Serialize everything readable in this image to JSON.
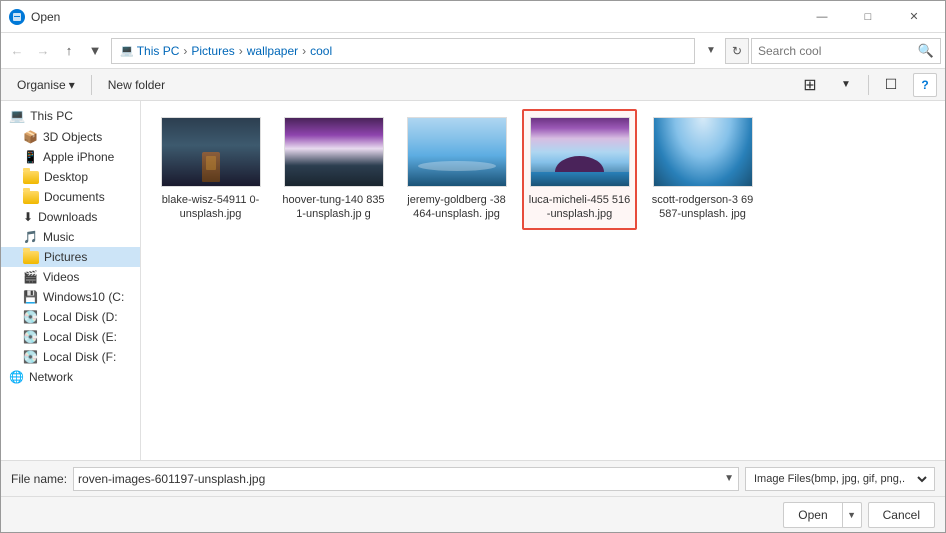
{
  "window": {
    "title": "Open",
    "icon": "open-folder-icon"
  },
  "title_bar_controls": {
    "minimize": "—",
    "maximize": "□",
    "close": "✕"
  },
  "nav": {
    "back": "←",
    "forward": "→",
    "up": "↑",
    "recent": "▾",
    "refresh": "⟳"
  },
  "breadcrumb": {
    "items": [
      {
        "label": "This PC",
        "icon": "computer-icon"
      },
      {
        "label": "Pictures",
        "icon": "folder-icon"
      },
      {
        "label": "wallpaper",
        "icon": "folder-icon"
      },
      {
        "label": "cool",
        "icon": "folder-icon"
      }
    ],
    "separator": "›"
  },
  "search": {
    "placeholder": "Search cool",
    "value": "",
    "icon": "search-icon"
  },
  "toolbar": {
    "organise_label": "Organise",
    "organise_arrow": "▾",
    "new_folder_label": "New folder",
    "view_icon_large": "⊞",
    "view_icon_pane": "⊟",
    "help_label": "?"
  },
  "sidebar": {
    "items": [
      {
        "id": "this-pc",
        "label": "This PC",
        "icon": "computer",
        "type": "computer"
      },
      {
        "id": "3d-objects",
        "label": "3D Objects",
        "icon": "3d",
        "type": "folder-special"
      },
      {
        "id": "apple-iphone",
        "label": "Apple iPhone",
        "icon": "phone",
        "type": "phone"
      },
      {
        "id": "desktop",
        "label": "Desktop",
        "icon": "folder",
        "type": "folder"
      },
      {
        "id": "documents",
        "label": "Documents",
        "icon": "folder",
        "type": "folder"
      },
      {
        "id": "downloads",
        "label": "Downloads",
        "icon": "folder-down",
        "type": "folder"
      },
      {
        "id": "music",
        "label": "Music",
        "icon": "music",
        "type": "folder-special"
      },
      {
        "id": "pictures",
        "label": "Pictures",
        "icon": "folder",
        "type": "folder",
        "selected": true
      },
      {
        "id": "videos",
        "label": "Videos",
        "icon": "video",
        "type": "folder-special"
      },
      {
        "id": "windows10",
        "label": "Windows10 (C:",
        "icon": "disk",
        "type": "disk"
      },
      {
        "id": "local-d",
        "label": "Local Disk (D:",
        "icon": "disk",
        "type": "disk"
      },
      {
        "id": "local-e",
        "label": "Local Disk (E:",
        "icon": "disk",
        "type": "disk"
      },
      {
        "id": "local-f",
        "label": "Local Disk (F:",
        "icon": "disk",
        "type": "disk"
      },
      {
        "id": "network",
        "label": "Network",
        "icon": "network",
        "type": "network"
      }
    ]
  },
  "files": [
    {
      "id": "blake",
      "name": "blake-wisz-54911 0-unsplash.jpg",
      "fullname": "blake-wisz-549110-unsplash.jpg",
      "thumb_type": "blake",
      "selected": false
    },
    {
      "id": "hoover",
      "name": "hoover-tung-140 8351-unsplash.jp g",
      "fullname": "hoover-tung-1408351-unsplash.jpg",
      "thumb_type": "hoover",
      "selected": false
    },
    {
      "id": "jeremy",
      "name": "jeremy-goldberg -38464-unsplash. jpg",
      "fullname": "jeremy-goldberg-38464-unsplash.jpg",
      "thumb_type": "jeremy",
      "selected": false
    },
    {
      "id": "luca",
      "name": "luca-micheli-455 516-unsplash.jpg",
      "fullname": "luca-micheli-455516-unsplash.jpg",
      "thumb_type": "luca",
      "selected": true
    },
    {
      "id": "scott",
      "name": "scott-rodgerson-3 69587-unsplash. jpg",
      "fullname": "scott-rodgerson-369587-unsplash.jpg",
      "thumb_type": "scott",
      "selected": false
    }
  ],
  "bottom": {
    "filename_label": "File name:",
    "filename_value": "roven-images-601197-unsplash.jpg",
    "filetype_label": "Image Files(bmp, jpg, gif, png,.",
    "open_label": "Open",
    "cancel_label": "Cancel",
    "dropdown_arrow": "▾"
  }
}
